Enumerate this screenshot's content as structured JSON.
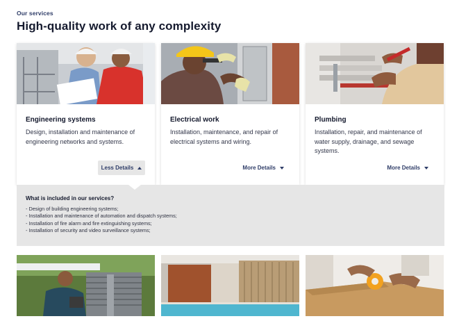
{
  "header": {
    "eyebrow": "Our services",
    "title": "High-quality work of any complexity"
  },
  "cards": [
    {
      "title": "Engineering systems",
      "description": "Design, installation and maintenance of engineering networks and systems.",
      "toggle_label": "Less Details",
      "expanded": true,
      "image_icon": "engineers-with-blueprint-photo"
    },
    {
      "title": "Electrical work",
      "description": "Installation, maintenance, and repair of electrical systems and wiring.",
      "toggle_label": "More Details",
      "expanded": false,
      "image_icon": "electrician-at-panel-photo"
    },
    {
      "title": "Plumbing",
      "description": "Installation, repair, and maintenance of water supply, drainage, and sewage systems.",
      "toggle_label": "More Details",
      "expanded": false,
      "image_icon": "plumber-with-pipes-photo"
    }
  ],
  "details": {
    "title": "What is included in our services?",
    "items": [
      "- Design of building engineering systems;",
      "- Installation and maintenance of automation and dispatch systems;",
      "- Installation of fire alarm and fire extinguishing systems;",
      "- Installation of security and video surveillance systems;"
    ]
  },
  "second_row": [
    {
      "image_icon": "hvac-technician-photo"
    },
    {
      "image_icon": "indoor-pool-photo"
    },
    {
      "image_icon": "packing-box-tape-photo"
    }
  ],
  "colors": {
    "accent": "#2f3d68",
    "details_bg": "#e6e6e6",
    "title": "#151a2e"
  }
}
